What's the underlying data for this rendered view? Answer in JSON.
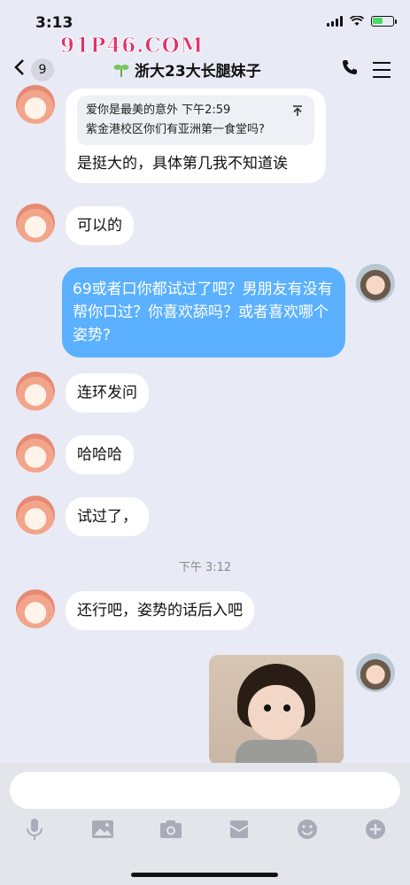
{
  "status": {
    "time": "3:13",
    "battery_level": 0.55
  },
  "watermark": "91P46.COM",
  "header": {
    "back_count": "9",
    "title": "浙大23大长腿妹子",
    "title_icon": "sprout-icon"
  },
  "messages": {
    "m1": {
      "quote_name_time": "爱你是最美的意外 下午2:59",
      "quote_text": "紫金港校区你们有亚洲第一食堂吗?",
      "text": "是挺大的，具体第几我不知道诶"
    },
    "m2": {
      "text": "可以的"
    },
    "m3": {
      "text": "69或者口你都试过了吧？男朋友有没有帮你口过？你喜欢舔吗？或者喜欢哪个姿势?"
    },
    "m4": {
      "text": "连环发问"
    },
    "m5": {
      "text": "哈哈哈"
    },
    "m6": {
      "text": "试过了，"
    },
    "timestamp": "下午 3:12",
    "m7": {
      "text": "还行吧，姿势的话后入吧"
    }
  },
  "input": {
    "placeholder": ""
  },
  "colors": {
    "outgoing_bubble": "#5bb1ff",
    "background": "#e8ebf5"
  }
}
